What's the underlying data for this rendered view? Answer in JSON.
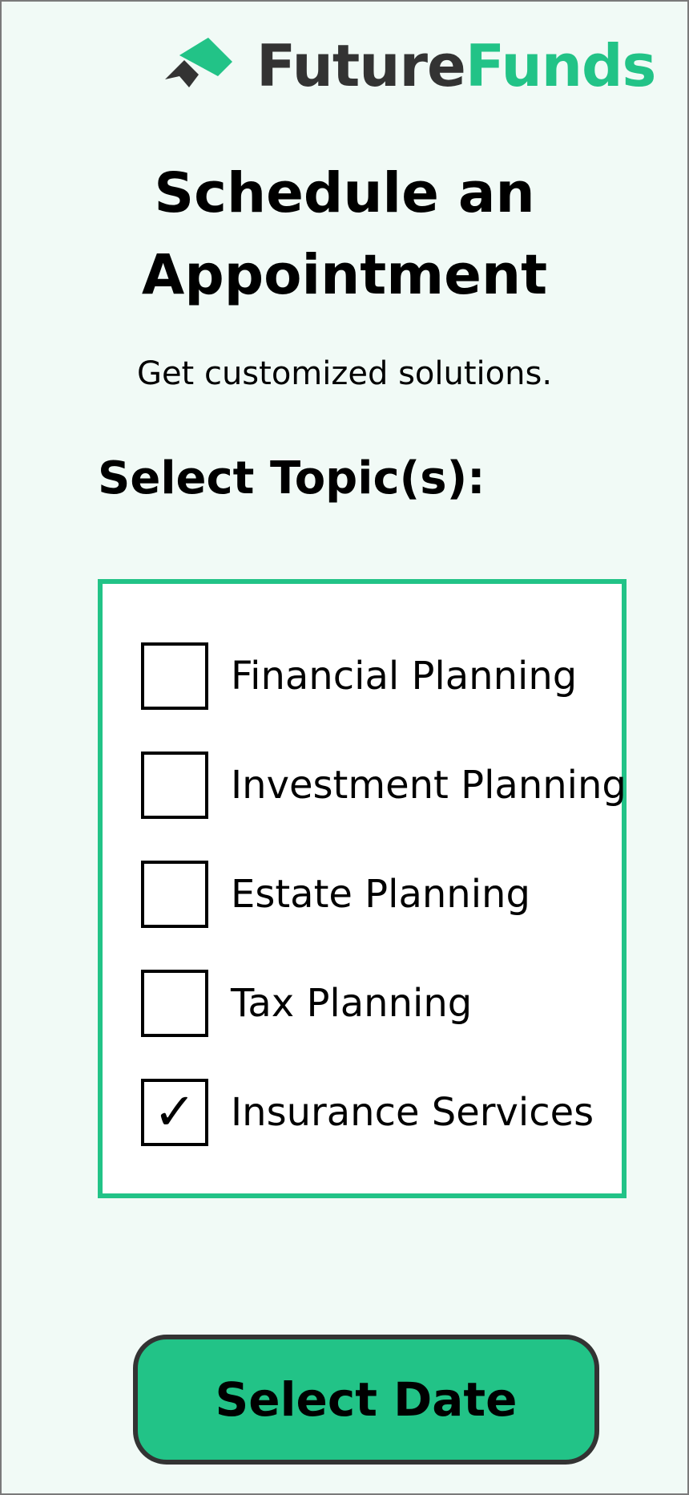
{
  "brand": {
    "name_part1": "Future",
    "name_part2": "Funds",
    "logo_icon": "house-arrow-logo-icon",
    "colors": {
      "dark": "#333333",
      "accent": "#22c387"
    }
  },
  "header": {
    "title_line1": "Schedule an",
    "title_line2": "Appointment",
    "subtitle": "Get customized solutions."
  },
  "topics": {
    "label": "Select Topic(s):",
    "options": [
      {
        "label": "Financial Planning",
        "checked": false
      },
      {
        "label": "Investment Planning",
        "checked": false
      },
      {
        "label": "Estate Planning",
        "checked": false
      },
      {
        "label": "Tax Planning",
        "checked": false
      },
      {
        "label": "Insurance Services",
        "checked": true,
        "check_glyph": "✓"
      }
    ]
  },
  "actions": {
    "select_date_label": "Select Date"
  },
  "colors": {
    "background": "#f1faf6",
    "panel_border": "#22c387",
    "button_fill": "#22c387",
    "button_border": "#333333"
  }
}
